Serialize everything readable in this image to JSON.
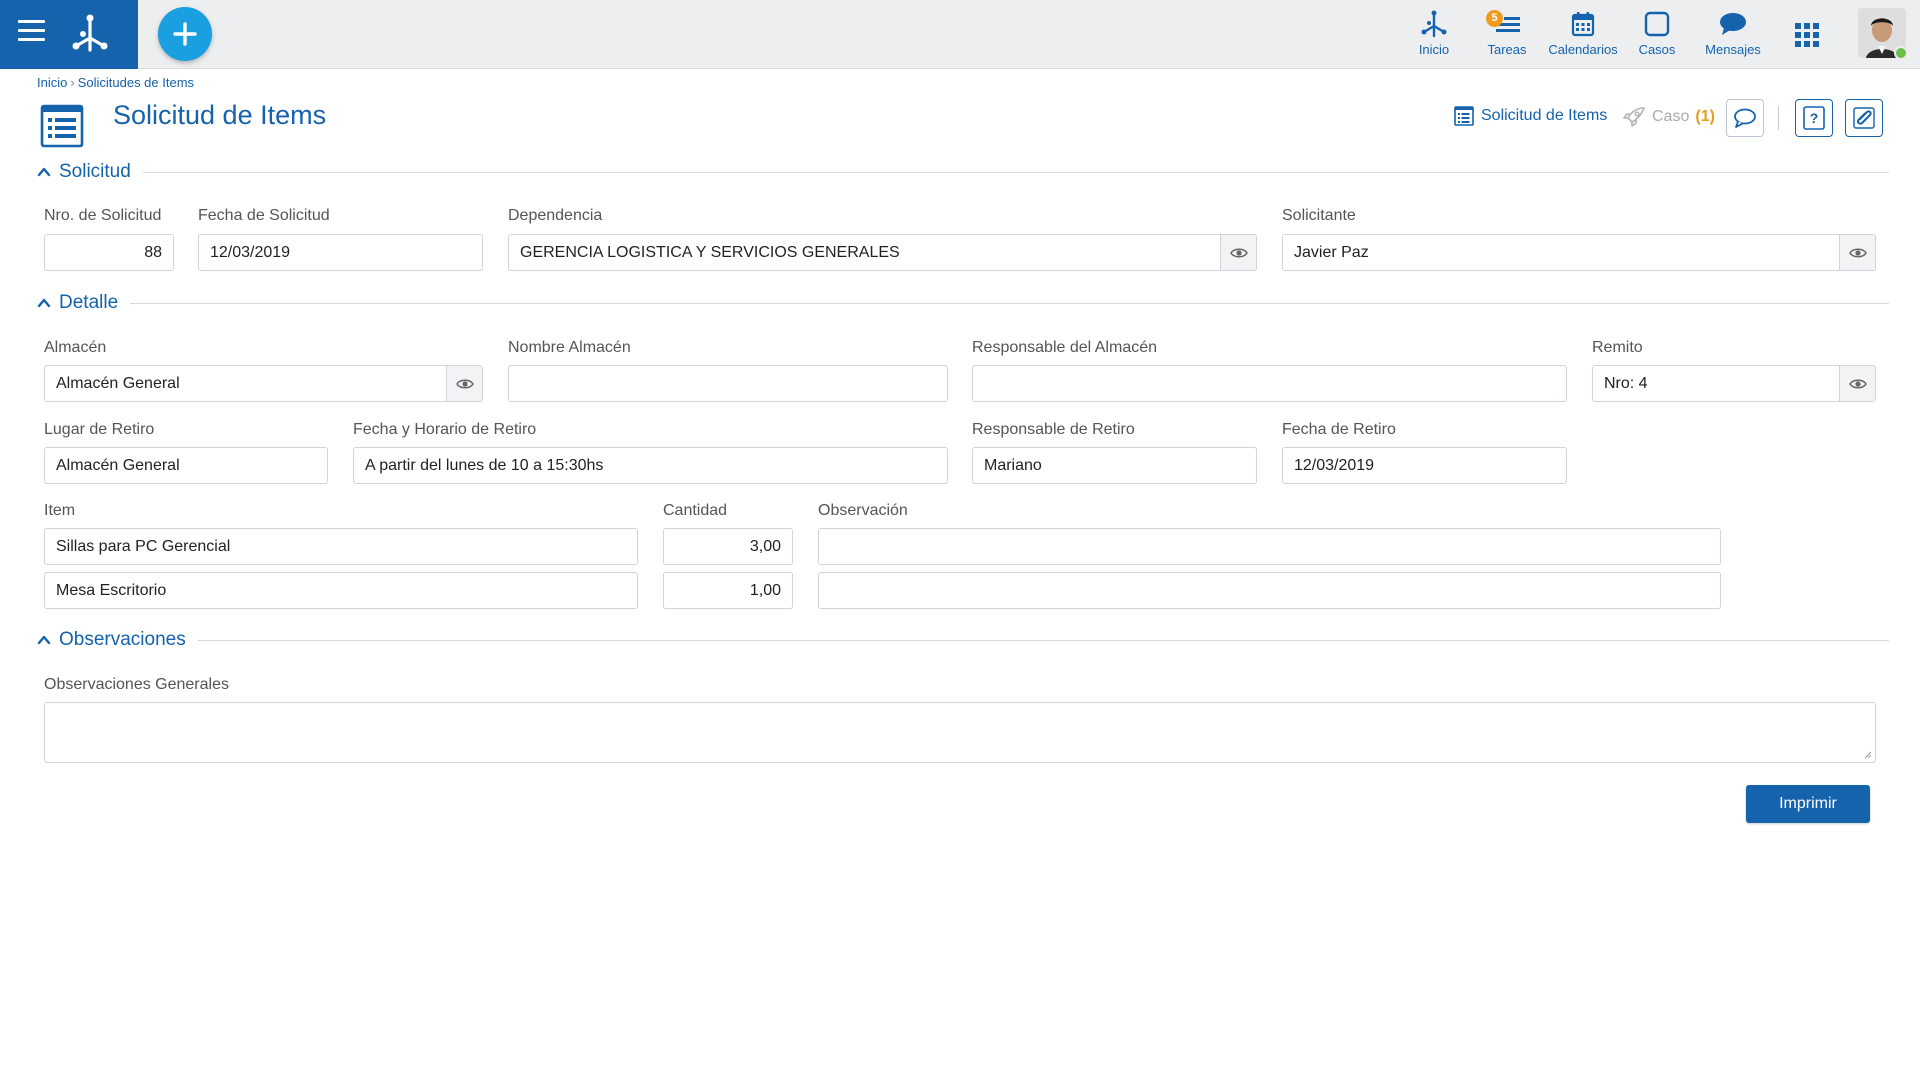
{
  "topbar": {
    "nav": [
      {
        "label": "Inicio",
        "icon": "flow-icon"
      },
      {
        "label": "Tareas",
        "icon": "tasks-icon",
        "badge": "5"
      },
      {
        "label": "Calendarios",
        "icon": "calendar-icon"
      },
      {
        "label": "Casos",
        "icon": "case-icon"
      },
      {
        "label": "Mensajes",
        "icon": "message-icon"
      }
    ],
    "accent": "#1562ad",
    "add_color": "#1aa0e0"
  },
  "breadcrumb": {
    "home": "Inicio",
    "current": "Solicitudes de Items"
  },
  "page": {
    "title": "Solicitud de Items",
    "form_link": "Solicitud de Items",
    "case_label": "Caso",
    "case_count": "(1)"
  },
  "sections": {
    "solicitud": "Solicitud",
    "detalle": "Detalle",
    "observaciones": "Observaciones"
  },
  "solicitud": {
    "nro_label": "Nro. de Solicitud",
    "nro_value": "88",
    "fecha_label": "Fecha de Solicitud",
    "fecha_value": "12/03/2019",
    "dependencia_label": "Dependencia",
    "dependencia_value": "GERENCIA LOGISTICA Y SERVICIOS GENERALES",
    "solicitante_label": "Solicitante",
    "solicitante_value": "Javier Paz"
  },
  "detalle": {
    "almacen_label": "Almacén",
    "almacen_value": "Almacén General",
    "nombre_almacen_label": "Nombre Almacén",
    "nombre_almacen_value": "",
    "responsable_almacen_label": "Responsable del Almacén",
    "responsable_almacen_value": "",
    "remito_label": "Remito",
    "remito_value": "Nro: 4",
    "lugar_label": "Lugar de Retiro",
    "lugar_value": "Almacén General",
    "horario_label": "Fecha y Horario de Retiro",
    "horario_value": "A partir del lunes de 10 a 15:30hs",
    "responsable_retiro_label": "Responsable de Retiro",
    "responsable_retiro_value": "Mariano",
    "fecha_retiro_label": "Fecha de Retiro",
    "fecha_retiro_value": "12/03/2019",
    "item_label": "Item",
    "cantidad_label": "Cantidad",
    "observacion_label": "Observación",
    "items": [
      {
        "item": "Sillas para PC Gerencial",
        "cantidad": "3,00",
        "observacion": ""
      },
      {
        "item": "Mesa Escritorio",
        "cantidad": "1,00",
        "observacion": ""
      }
    ]
  },
  "observaciones": {
    "generales_label": "Observaciones Generales",
    "generales_value": ""
  },
  "actions": {
    "print_label": "Imprimir"
  }
}
